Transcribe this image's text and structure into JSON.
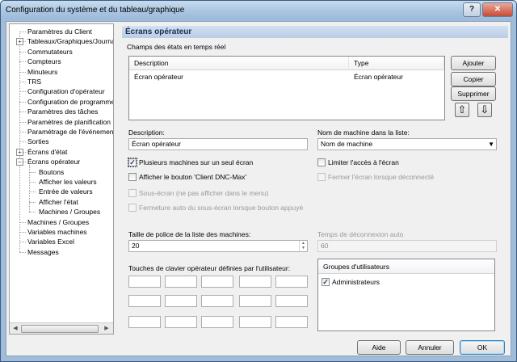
{
  "window": {
    "title": "Configuration du système et du tableau/graphique",
    "help_btn": "?",
    "close_btn": "✕"
  },
  "tree": {
    "items": [
      {
        "label": "Paramètres du Client",
        "level": 0,
        "expander": ""
      },
      {
        "label": "Tableaux/Graphiques/Journa",
        "level": 0,
        "expander": "+"
      },
      {
        "label": "Commutateurs",
        "level": 0,
        "expander": ""
      },
      {
        "label": "Compteurs",
        "level": 0,
        "expander": ""
      },
      {
        "label": "Minuteurs",
        "level": 0,
        "expander": ""
      },
      {
        "label": "TRS",
        "level": 0,
        "expander": ""
      },
      {
        "label": "Configuration d'opérateur",
        "level": 0,
        "expander": ""
      },
      {
        "label": "Configuration de programme",
        "level": 0,
        "expander": ""
      },
      {
        "label": "Paramètres des tâches",
        "level": 0,
        "expander": ""
      },
      {
        "label": "Paramètres de planification",
        "level": 0,
        "expander": ""
      },
      {
        "label": "Paramétrage de l'événement",
        "level": 0,
        "expander": ""
      },
      {
        "label": "Sorties",
        "level": 0,
        "expander": ""
      },
      {
        "label": "Écrans d'état",
        "level": 0,
        "expander": "+"
      },
      {
        "label": "Écrans opérateur",
        "level": 0,
        "expander": "−"
      },
      {
        "label": "Boutons",
        "level": 1,
        "expander": ""
      },
      {
        "label": "Afficher les valeurs",
        "level": 1,
        "expander": ""
      },
      {
        "label": "Entrée de valeurs",
        "level": 1,
        "expander": ""
      },
      {
        "label": "Afficher l'état",
        "level": 1,
        "expander": ""
      },
      {
        "label": "Machines / Groupes",
        "level": 1,
        "expander": ""
      },
      {
        "label": "Machines / Groupes",
        "level": 0,
        "expander": ""
      },
      {
        "label": "Variables machines",
        "level": 0,
        "expander": ""
      },
      {
        "label": "Variables Excel",
        "level": 0,
        "expander": ""
      },
      {
        "label": "Messages",
        "level": 0,
        "expander": ""
      }
    ],
    "scroll_left": "◀",
    "scroll_right": "▶"
  },
  "panel": {
    "title": "Écrans opérateur",
    "realtime_label": "Champs des états en temps réel",
    "list": {
      "columns": [
        "Description",
        "Type"
      ],
      "rows": [
        [
          "Écran opérateur",
          "Écran opérateur"
        ]
      ]
    },
    "buttons": {
      "add": "Ajouter",
      "copy": "Copier",
      "delete": "Supprimer",
      "up": "⇧",
      "down": "⇩"
    },
    "description_label": "Description:",
    "description_value": "Écran opérateur",
    "machine_name_label": "Nom de machine dans la liste:",
    "machine_name_value": "Nom de machine",
    "checkboxes": {
      "multi_machines": {
        "label": "Plusieurs machines sur un seul écran",
        "checked": true,
        "enabled": true
      },
      "show_dnc_max": {
        "label": "Afficher le bouton 'Client DNC-Max'",
        "checked": false,
        "enabled": true
      },
      "sub_screen": {
        "label": "Sous-écran (ne pas afficher dans le menu)",
        "checked": false,
        "enabled": false
      },
      "auto_close": {
        "label": "Fermeture auto du sous-écran lorsque bouton appuyé",
        "checked": false,
        "enabled": false
      },
      "limit_access": {
        "label": "Limiter l'accès à l'écran",
        "checked": false,
        "enabled": true
      },
      "close_disconnected": {
        "label": "Fermer l'écran lorsque déconnecté",
        "checked": false,
        "enabled": false
      }
    },
    "font_size_label": "Taille de police de la liste des machines:",
    "font_size_value": "20",
    "timeout_label": "Temps de déconnexion auto",
    "timeout_value": "60",
    "keys_label": "Touches de clavier opérateur définies par l'utilisateur:",
    "user_groups": {
      "title": "Groupes d'utilisateurs",
      "items": [
        {
          "label": "Administrateurs",
          "checked": true
        }
      ]
    }
  },
  "footer": {
    "help": "Aide",
    "cancel": "Annuler",
    "ok": "OK"
  }
}
